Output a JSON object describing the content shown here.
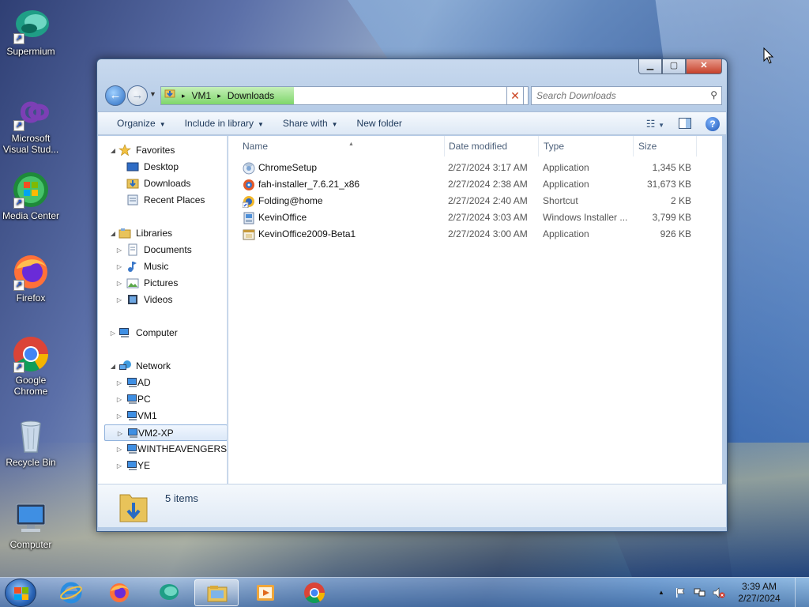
{
  "desktop": {
    "icons": [
      {
        "label": "Supermium",
        "icon": "supermium-icon"
      },
      {
        "label": "Microsoft Visual Stud...",
        "icon": "visual-studio-icon"
      },
      {
        "label": "Media Center",
        "icon": "media-center-icon"
      },
      {
        "label": "Firefox",
        "icon": "firefox-icon"
      },
      {
        "label": "Google Chrome",
        "icon": "chrome-icon"
      },
      {
        "label": "Recycle Bin",
        "icon": "recycle-bin-icon"
      },
      {
        "label": "Computer",
        "icon": "computer-icon"
      }
    ]
  },
  "window": {
    "caption_buttons": {
      "minimize": "▁",
      "maximize": "▢",
      "close": "✕"
    },
    "address": {
      "segments": [
        "VM1",
        "Downloads"
      ],
      "separator": "▸"
    },
    "search": {
      "placeholder": "Search Downloads"
    },
    "toolbar": {
      "organize": "Organize",
      "include_in_library": "Include in library",
      "share_with": "Share with",
      "new_folder": "New folder"
    },
    "nav": {
      "favorites": {
        "label": "Favorites",
        "items": [
          "Desktop",
          "Downloads",
          "Recent Places"
        ]
      },
      "libraries": {
        "label": "Libraries",
        "items": [
          "Documents",
          "Music",
          "Pictures",
          "Videos"
        ]
      },
      "computer": {
        "label": "Computer"
      },
      "network": {
        "label": "Network",
        "items": [
          "AD",
          "PC",
          "VM1",
          "VM2-XP",
          "WINTHEAVENGERS",
          "YE"
        ],
        "selected": "VM2-XP"
      }
    },
    "columns": {
      "name": "Name",
      "date": "Date modified",
      "type": "Type",
      "size": "Size"
    },
    "files": [
      {
        "name": "ChromeSetup",
        "date": "2/27/2024 3:17 AM",
        "type": "Application",
        "size": "1,345 KB",
        "icon": "chrome-setup-icon"
      },
      {
        "name": "fah-installer_7.6.21_x86",
        "date": "2/27/2024 2:38 AM",
        "type": "Application",
        "size": "31,673 KB",
        "icon": "installer-icon"
      },
      {
        "name": "Folding@home",
        "date": "2/27/2024 2:40 AM",
        "type": "Shortcut",
        "size": "2 KB",
        "icon": "shortcut-icon"
      },
      {
        "name": "KevinOffice",
        "date": "2/27/2024 3:03 AM",
        "type": "Windows Installer ...",
        "size": "3,799 KB",
        "icon": "msi-icon"
      },
      {
        "name": "KevinOffice2009-Beta1",
        "date": "2/27/2024 3:00 AM",
        "type": "Application",
        "size": "926 KB",
        "icon": "app-icon"
      }
    ],
    "details": {
      "count": "5 items"
    }
  },
  "taskbar": {
    "apps": [
      "internet-explorer-icon",
      "firefox-icon",
      "supermium-icon",
      "explorer-icon",
      "media-player-icon",
      "chrome-icon"
    ],
    "active": "explorer-icon",
    "tray": {
      "show_hidden": "▲"
    },
    "clock": {
      "time": "3:39 AM",
      "date": "2/27/2024"
    }
  }
}
